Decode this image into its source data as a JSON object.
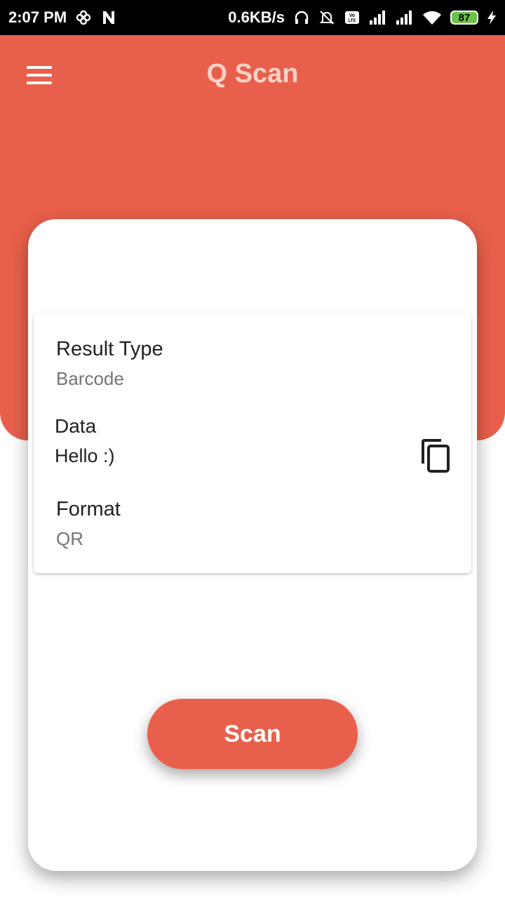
{
  "status_bar": {
    "time": "2:07 PM",
    "network_speed": "0.6KB/s",
    "battery": "87",
    "icons": [
      "pinwheel-icon",
      "n-icon",
      "headset-icon",
      "alarm-off-icon",
      "volte-icon",
      "signal-icon",
      "signal-icon",
      "wifi-icon",
      "battery-icon",
      "charging-icon"
    ]
  },
  "header": {
    "title": "Q Scan",
    "menu_icon": "hamburger-menu-icon"
  },
  "result": {
    "type_label": "Result Type",
    "type_value": "Barcode",
    "data_label": "Data",
    "data_value": "Hello :)",
    "format_label": "Format",
    "format_value": "QR",
    "copy_icon": "copy-icon"
  },
  "actions": {
    "scan_label": "Scan"
  },
  "colors": {
    "accent": "#e8604b",
    "title_text": "#fbd2c8",
    "battery": "#6cc24a"
  }
}
